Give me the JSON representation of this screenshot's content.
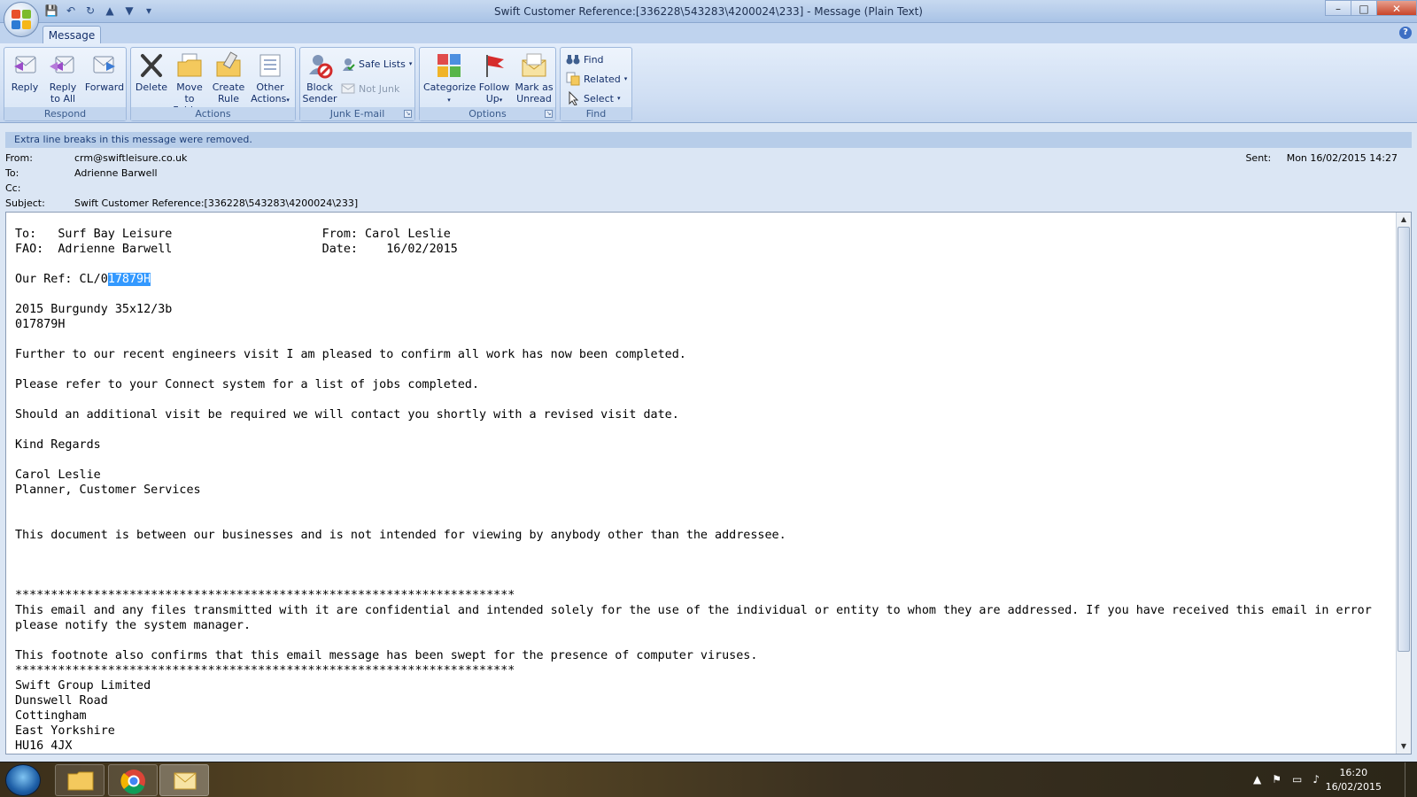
{
  "window": {
    "title": "Swift Customer Reference:[336228\\543283\\4200024\\233] - Message (Plain Text)",
    "minimize_glyph": "–",
    "maximize_glyph": "□",
    "close_glyph": "✕"
  },
  "quick_access": {
    "icons": [
      "save-icon",
      "undo-icon",
      "redo-icon",
      "previous-icon",
      "next-icon",
      "customize-icon"
    ],
    "glyphs": [
      "💾",
      "↶",
      "↻",
      "▲",
      "▼",
      "▾"
    ]
  },
  "tabs": [
    {
      "label": "Message",
      "active": true
    }
  ],
  "ribbon": {
    "respond": {
      "label": "Respond",
      "reply": "Reply",
      "reply_all_line1": "Reply",
      "reply_all_line2": "to All",
      "forward": "Forward"
    },
    "actions": {
      "label": "Actions",
      "delete": "Delete",
      "move_line1": "Move to",
      "move_line2": "Folder",
      "rule_line1": "Create",
      "rule_line2": "Rule",
      "other_line1": "Other",
      "other_line2": "Actions"
    },
    "junk": {
      "label": "Junk E-mail",
      "block_line1": "Block",
      "block_line2": "Sender",
      "safe_lists": "Safe Lists",
      "not_junk": "Not Junk"
    },
    "options": {
      "label": "Options",
      "categorize": "Categorize",
      "follow_line1": "Follow",
      "follow_line2": "Up",
      "mark_line1": "Mark as",
      "mark_line2": "Unread"
    },
    "find": {
      "label": "Find",
      "find": "Find",
      "related": "Related",
      "select": "Select"
    }
  },
  "infobar": "Extra line breaks in this message were removed.",
  "headers": {
    "from_label": "From:",
    "from": "crm@swiftleisure.co.uk",
    "to_label": "To:",
    "to": "Adrienne Barwell",
    "cc_label": "Cc:",
    "cc": "",
    "subject_label": "Subject:",
    "subject": "Swift Customer Reference:[336228\\543283\\4200024\\233]",
    "sent_label": "Sent:",
    "sent": "Mon 16/02/2015 14:27"
  },
  "body": {
    "line1": "To:   Surf Bay Leisure                     From: Carol Leslie",
    "line2": "FAO:  Adrienne Barwell                     Date:    16/02/2015",
    "ref_prefix": "Our Ref: CL/0",
    "ref_selected": "17879H",
    "model": "2015 Burgundy 35x12/3b",
    "code": "017879H",
    "para1": "Further to our recent engineers visit I am pleased to confirm all work has now been completed.",
    "para2": "Please refer to your Connect system for a list of jobs completed.",
    "para3": "Should an additional visit be required we will contact you shortly with a revised visit date.",
    "regards": "Kind Regards",
    "signer": "Carol Leslie",
    "signer_title": "Planner, Customer Services",
    "notice": "This document is between our businesses and is not intended for viewing by anybody other than the addressee.",
    "stars": "**********************************************************************",
    "conf1": "This email and any files transmitted with it are confidential and intended solely for the use of the individual or entity to whom they are addressed. If you have received this email in error",
    "conf2": "please notify the system manager.",
    "footnote": "This footnote also confirms that this email message has been swept for the presence of computer viruses.",
    "addr1": "Swift Group Limited",
    "addr2": "Dunswell Road",
    "addr3": "Cottingham",
    "addr4": "East Yorkshire",
    "addr5": "HU16 4JX"
  },
  "taskbar": {
    "items": [
      "windows-explorer",
      "google-chrome",
      "outlook-message"
    ],
    "time": "16:20",
    "date": "16/02/2015"
  },
  "colors": {
    "ribbon_bg": "#dbe6f4",
    "selection": "#3399ff",
    "close_button": "#c8452a"
  }
}
